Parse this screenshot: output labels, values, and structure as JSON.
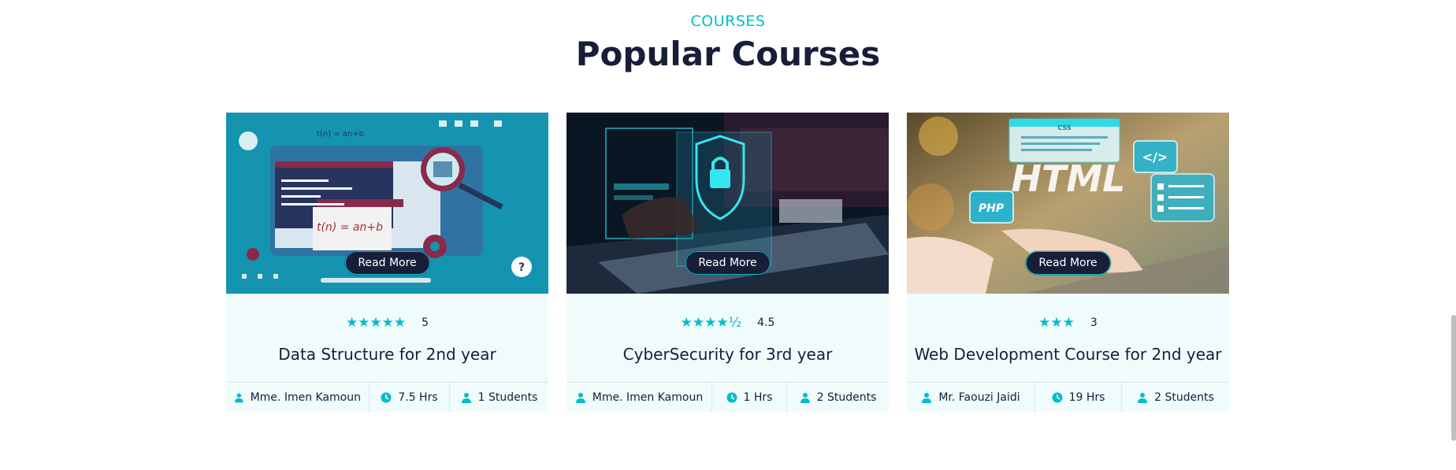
{
  "section": {
    "eyebrow": "COURSES",
    "title": "Popular Courses"
  },
  "colors": {
    "accent": "#06bbcc",
    "dark": "#181d38",
    "card_bg": "#f0fbfc"
  },
  "courses": [
    {
      "read_more": "Read More",
      "stars": "★★★★★",
      "rating": "5",
      "title": "Data Structure for 2nd year",
      "instructor": "Mme. Imen Kamoun",
      "duration": "7.5 Hrs",
      "students": "1 Students",
      "thumb_text": "t(n) = an+b",
      "thumb_text_small": "t(n) = an+b"
    },
    {
      "read_more": "Read More",
      "stars": "★★★★½",
      "rating": "4.5",
      "title": "CyberSecurity for 3rd year",
      "instructor": "Mme. Imen Kamoun",
      "duration": "1 Hrs",
      "students": "2 Students"
    },
    {
      "read_more": "Read More",
      "stars": "★★★",
      "rating": "3",
      "title": "Web Development Course for 2nd year",
      "instructor": "Mr. Faouzi Jaidi",
      "duration": "19 Hrs",
      "students": "2 Students",
      "thumb_html": "HTML",
      "thumb_php": "PHP",
      "thumb_css": "CSS",
      "thumb_tag": "</>"
    }
  ]
}
